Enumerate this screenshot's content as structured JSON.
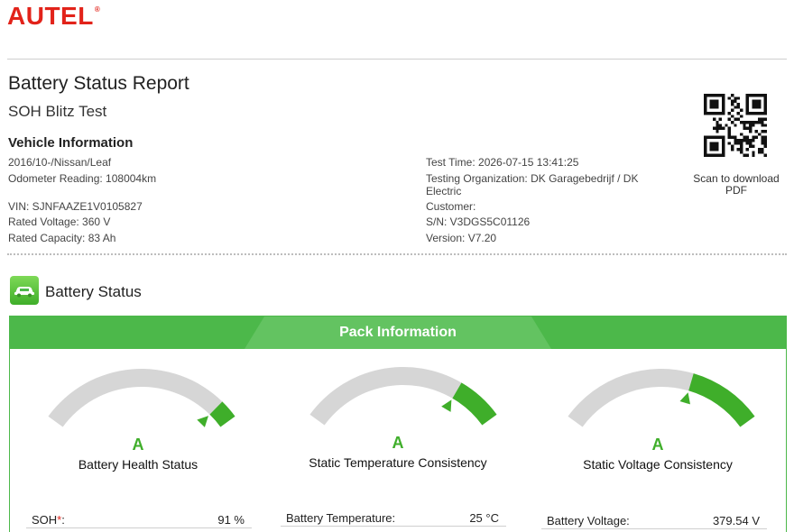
{
  "brand": {
    "logo_text": "AUTEL",
    "trademark": "®",
    "brand_color": "#e2231a"
  },
  "report": {
    "title": "Battery Status Report",
    "subtitle": "SOH Blitz Test"
  },
  "vehicle_info": {
    "heading": "Vehicle Information",
    "model": "2016/10-/Nissan/Leaf",
    "odometer": "Odometer Reading: 108004km",
    "vin": "VIN: SJNFAAZE1V0105827",
    "rated_voltage": "Rated Voltage: 360 V",
    "rated_capacity": "Rated Capacity: 83 Ah"
  },
  "test_info": {
    "test_time": "Test Time: 2026-07-15 13:41:25",
    "organization": "Testing Organization: DK Garagebedrijf / DK Electric",
    "customer": "Customer:",
    "serial": "S/N: V3DGS5C01126",
    "version": "Version: V7.20"
  },
  "qr": {
    "caption": "Scan to download PDF"
  },
  "battery_status": {
    "title": "Battery Status",
    "accent_color": "#4cb84a"
  },
  "pack": {
    "title": "Pack Information",
    "gauges": [
      {
        "grade": "A",
        "label": "Battery Health Status",
        "level": 0.91
      },
      {
        "grade": "A",
        "label": "Static Temperature Consistency",
        "level": 0.78
      },
      {
        "grade": "A",
        "label": "Static Voltage Consistency",
        "level": 0.65
      }
    ],
    "rows": [
      {
        "key": "SOH",
        "star": "*",
        "colon": ":",
        "value": "91 %"
      },
      {
        "key": "Battery Temperature:",
        "value": "25 °C"
      },
      {
        "key": "Battery Voltage:",
        "value": "379.54 V"
      }
    ]
  }
}
